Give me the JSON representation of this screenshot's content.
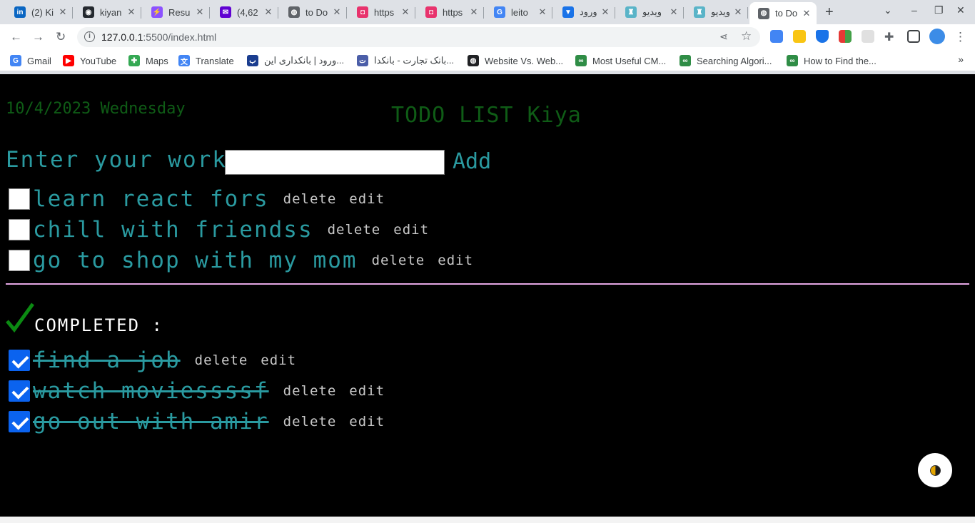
{
  "browser": {
    "tabs": [
      {
        "title": "(2) Ki",
        "icon": "linkedin-icon",
        "color": "#0a66c2",
        "glyph": "in"
      },
      {
        "title": "kiyan",
        "icon": "github-icon",
        "color": "#24292f",
        "glyph": "◉"
      },
      {
        "title": "Resu",
        "icon": "vite-icon",
        "color": "#8c52ff",
        "glyph": "⚡"
      },
      {
        "title": "(4,62",
        "icon": "mail-icon",
        "color": "#6001d2",
        "glyph": "✉"
      },
      {
        "title": "to Do",
        "icon": "globe-icon",
        "color": "#5f6368",
        "glyph": "◍"
      },
      {
        "title": "https",
        "icon": "app-icon",
        "color": "#e8336d",
        "glyph": "◘"
      },
      {
        "title": "https",
        "icon": "app-icon",
        "color": "#e8336d",
        "glyph": "◘"
      },
      {
        "title": "leito",
        "icon": "google-icon",
        "color": "#4285f4",
        "glyph": "G"
      },
      {
        "title": "ورود",
        "icon": "vpn-icon",
        "color": "#1a73e8",
        "glyph": "▼"
      },
      {
        "title": "ویدیو",
        "icon": "tshirt-icon",
        "color": "#5ab4c8",
        "glyph": "♜"
      },
      {
        "title": "ویدیو",
        "icon": "tshirt-icon",
        "color": "#5ab4c8",
        "glyph": "♜"
      },
      {
        "title": "to Do",
        "icon": "globe-icon",
        "color": "#5f6368",
        "glyph": "◍",
        "active": true
      }
    ],
    "url_host": "127.0.0.1",
    "url_rest": ":5500/index.html",
    "bookmarks": [
      {
        "label": "Gmail",
        "icon": "google-icon",
        "color": "#4285f4",
        "glyph": "G"
      },
      {
        "label": "YouTube",
        "icon": "youtube-icon",
        "color": "#ff0000",
        "glyph": "▶"
      },
      {
        "label": "Maps",
        "icon": "maps-icon",
        "color": "#34a853",
        "glyph": "✚"
      },
      {
        "label": "Translate",
        "icon": "translate-icon",
        "color": "#4285f4",
        "glyph": "文"
      },
      {
        "label": "ورود | بانکداری این...",
        "icon": "bank-icon",
        "color": "#1a3d8f",
        "glyph": "ب"
      },
      {
        "label": "بانک تجارت - بانکدا...",
        "icon": "bank-icon",
        "color": "#4b5ea8",
        "glyph": "ت"
      },
      {
        "label": "Website Vs. Web...",
        "icon": "globe-icon",
        "color": "#202124",
        "glyph": "◍"
      },
      {
        "label": "Most Useful CM...",
        "icon": "gfg-icon",
        "color": "#2f8d46",
        "glyph": "∞"
      },
      {
        "label": "Searching Algori...",
        "icon": "gfg-icon",
        "color": "#2f8d46",
        "glyph": "∞"
      },
      {
        "label": "How to Find the...",
        "icon": "gfg-icon",
        "color": "#2f8d46",
        "glyph": "∞"
      }
    ]
  },
  "page": {
    "date": "10/4/2023 Wednesday",
    "title": "TODO LIST Kiya",
    "enter_label": "Enter your work:",
    "input_value": "",
    "add_label": "Add",
    "completed_label": "COMPLETED :",
    "delete_label": "delete",
    "edit_label": "edit",
    "todos": [
      {
        "text": "learn react fors",
        "done": false
      },
      {
        "text": "chill with friendss",
        "done": false
      },
      {
        "text": "go to shop with my mom",
        "done": false
      }
    ],
    "completed": [
      {
        "text": "find a job",
        "done": true
      },
      {
        "text": "watch moviessssf",
        "done": true
      },
      {
        "text": "go out with amir",
        "done": true
      }
    ],
    "colors": {
      "background": "#000000",
      "text_teal": "#2a9aa0",
      "title_green": "#0f5c16",
      "divider": "#e5a7e5",
      "checkbox_checked": "#0b63ef"
    }
  }
}
